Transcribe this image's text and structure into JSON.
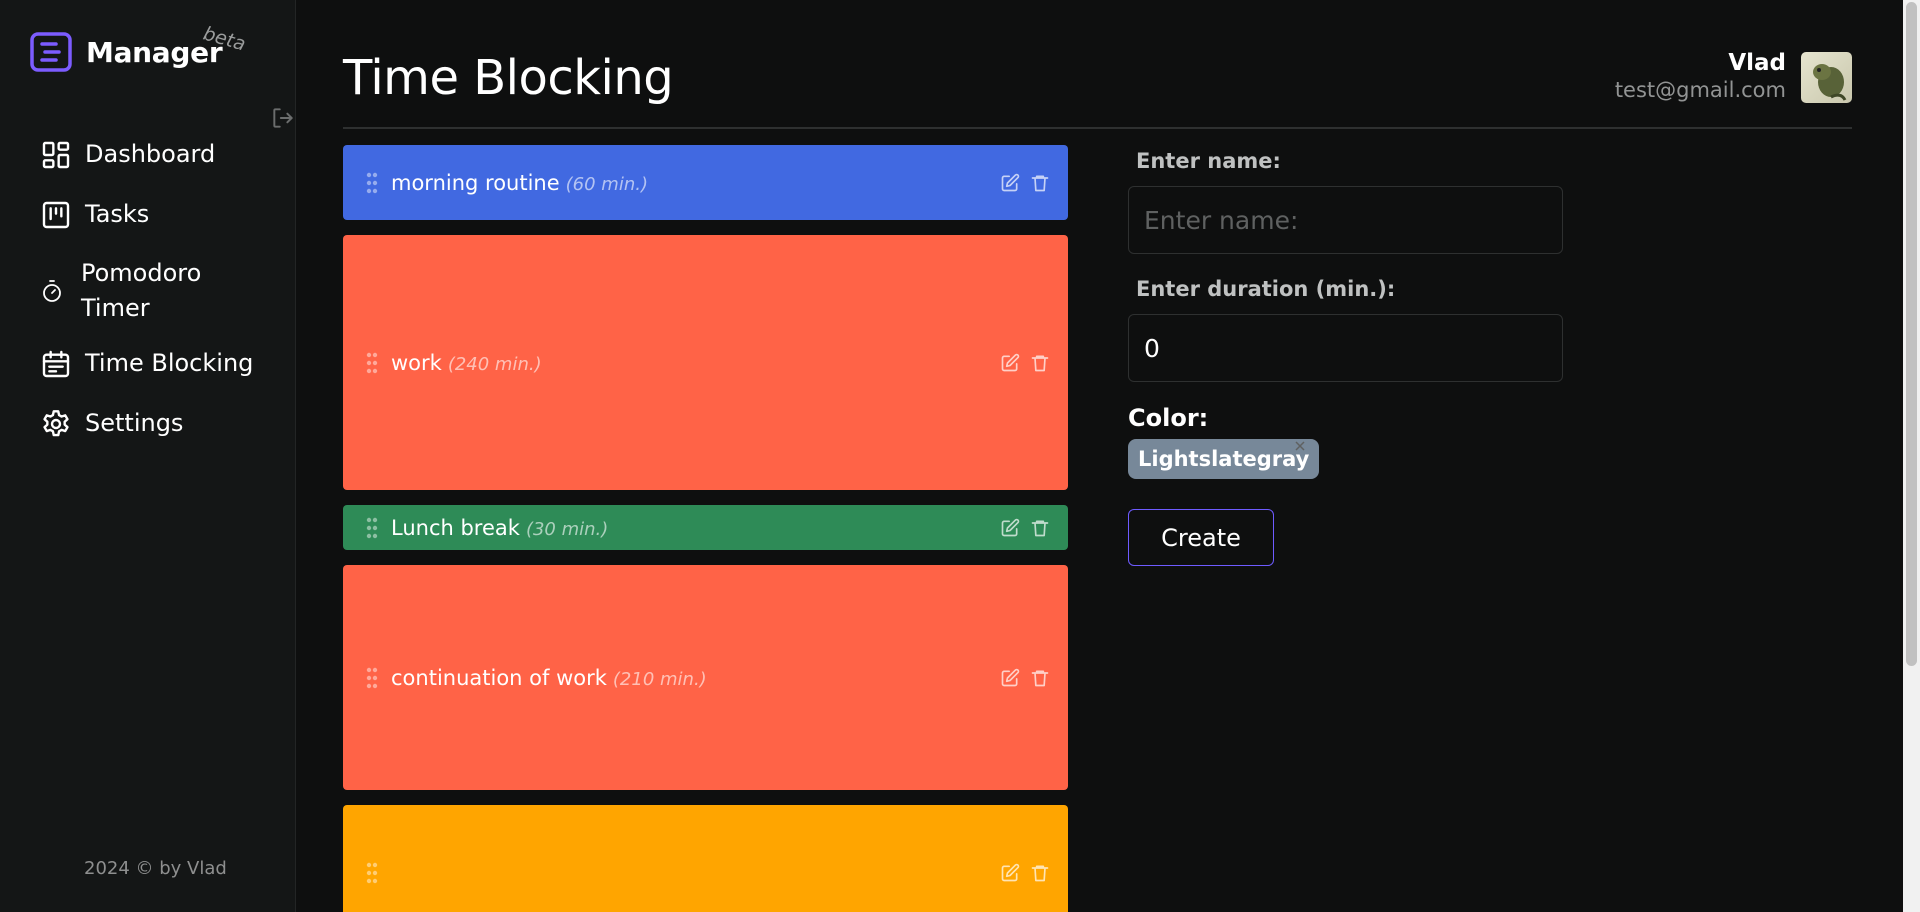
{
  "app": {
    "name": "Manager",
    "badge": "beta",
    "accent_color": "#7c5cff"
  },
  "sidebar": {
    "items": [
      {
        "label": "Dashboard",
        "icon": "dashboard-icon"
      },
      {
        "label": "Tasks",
        "icon": "kanban-icon"
      },
      {
        "label": "Pomodoro Timer",
        "icon": "timer-icon"
      },
      {
        "label": "Time Blocking",
        "icon": "calendar-icon"
      },
      {
        "label": "Settings",
        "icon": "gear-icon"
      }
    ],
    "logout_icon": "logout-icon",
    "footer": "2024 © by Vlad"
  },
  "header": {
    "title": "Time Blocking",
    "user_name": "Vlad",
    "user_email": "test@gmail.com"
  },
  "blocks": [
    {
      "name": "morning routine",
      "duration": "(60 min.)",
      "minutes": 60,
      "color": "#4169e1"
    },
    {
      "name": "work",
      "duration": "(240 min.)",
      "minutes": 240,
      "color": "#ff6347"
    },
    {
      "name": "Lunch break",
      "duration": "(30 min.)",
      "minutes": 30,
      "color": "#2e8b57"
    },
    {
      "name": "continuation of work",
      "duration": "(210 min.)",
      "minutes": 210,
      "color": "#ff6347"
    },
    {
      "name": "",
      "duration": "",
      "minutes": 120,
      "color": "#ffa500"
    }
  ],
  "form": {
    "name_label": "Enter name:",
    "name_placeholder": "Enter name:",
    "name_value": "",
    "duration_label": "Enter duration (min.):",
    "duration_value": "0",
    "color_label": "Color:",
    "color_selected": "Lightslategray",
    "color_selected_hex": "#778899",
    "create_label": "Create"
  }
}
